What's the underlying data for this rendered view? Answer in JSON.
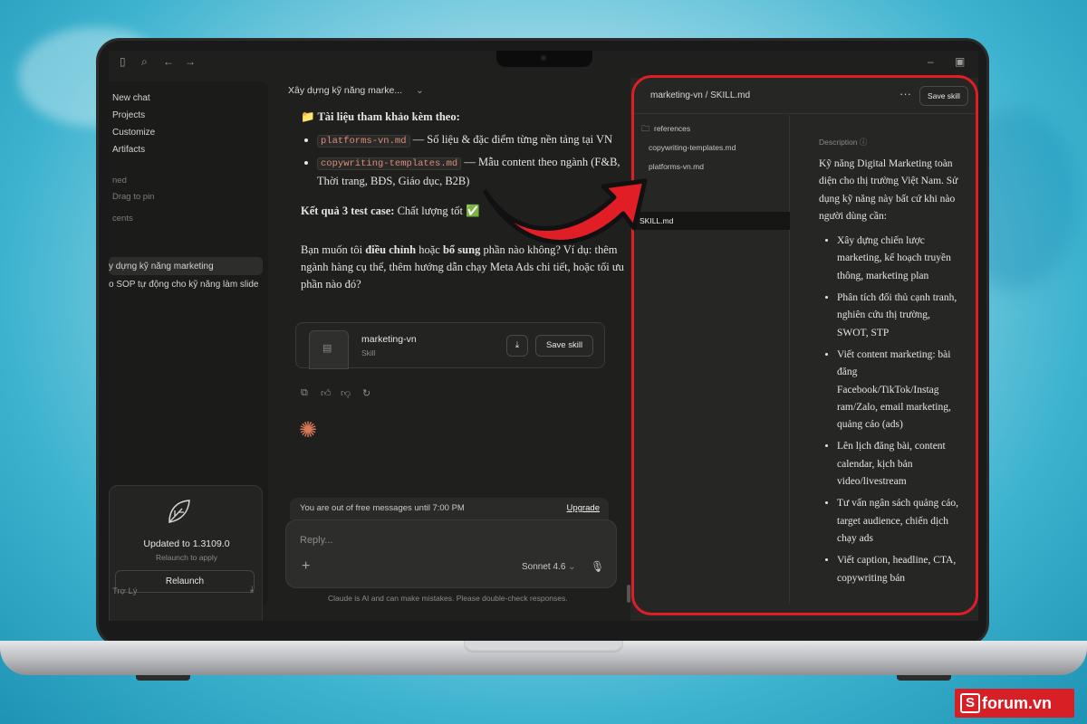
{
  "sidebar": {
    "new_chat": "New chat",
    "projects": "Projects",
    "customize": "Customize",
    "artifacts": "Artifacts",
    "pinned_label": "ned",
    "drag_to_pin": "Drag to pin",
    "recents_label": "cents",
    "recent_items": [
      "y dựng kỹ năng marketing",
      "o SOP tự động cho kỹ năng làm slide"
    ],
    "update_title": "Updated to 1.3109.0",
    "update_sub": "Relaunch to apply",
    "relaunch_label": "Relaunch",
    "user_name": "Trợ Lý"
  },
  "chat": {
    "title": "Xây dựng kỹ năng marke...",
    "refs_heading": "📁 Tài liệu tham khảo kèm theo:",
    "ref1_file": "platforms-vn.md",
    "ref1_text": " — Số liệu & đặc điểm từng nền tảng tại VN",
    "ref2_file": "copywriting-templates.md",
    "ref2_text": " — Mẫu content theo ngành (F&B, Thời trang, BĐS, Giáo dục, B2B)",
    "result_bold": "Kết quả 3 test case:",
    "result_text": " Chất lượng tốt ✅",
    "question_pre": "Bạn muốn tôi ",
    "question_b1": "điều chỉnh",
    "question_mid": " hoặc ",
    "question_b2": "bổ sung",
    "question_post": " phần nào không? Ví dụ: thêm ngành hàng cụ thể, thêm hướng dẫn chạy Meta Ads chi tiết, hoặc tối ưu phần nào đó?",
    "skill_name": "marketing-vn",
    "skill_type": "Skill",
    "save_skill": "Save skill",
    "notice_text": "You are out of free messages until 7:00 PM",
    "upgrade": "Upgrade",
    "reply_placeholder": "Reply...",
    "model": "Sonnet 4.6",
    "disclaimer": "Claude is AI and can make mistakes. Please double-check responses."
  },
  "panel": {
    "path": "marketing-vn / SKILL.md",
    "save_skill": "Save skill",
    "folder": "references",
    "files": [
      "copywriting-templates.md",
      "platforms-vn.md",
      "SKILL.md"
    ],
    "description_label": "Description",
    "intro": "Kỹ năng Digital Marketing toàn diện cho thị trường Việt Nam. Sử dụng kỹ năng này bất cứ khi nào người dùng cần:",
    "bullets": [
      "Xây dựng chiến lược marketing, kế hoạch truyền thông, marketing plan",
      "Phân tích đối thủ cạnh tranh, nghiên cứu thị trường, SWOT, STP",
      "Viết content marketing: bài đăng Facebook/TikTok/Instag ram/Zalo, email marketing, quảng cáo (ads)",
      "Lên lịch đăng bài, content calendar, kịch bản video/livestream",
      "Tư vấn ngân sách quảng cáo, target audience, chiến dịch chạy ads",
      "Viết caption, headline, CTA, copywriting bán"
    ]
  },
  "brand": {
    "name": "forum.vn",
    "mark": "S",
    "color": "#d91f26"
  },
  "colors": {
    "highlight": "#e11d26",
    "accent": "#d97757"
  },
  "icons": [
    "sidebar-toggle-icon",
    "search-icon",
    "back-icon",
    "forward-icon",
    "minimize-icon",
    "restore-icon",
    "leaf-icon",
    "download-icon",
    "copy-icon",
    "thumbs-up-icon",
    "thumbs-down-icon",
    "retry-icon",
    "sparkle-icon",
    "plus-icon",
    "mic-icon",
    "more-icon",
    "folder-icon",
    "info-icon",
    "chevron-down-icon"
  ]
}
